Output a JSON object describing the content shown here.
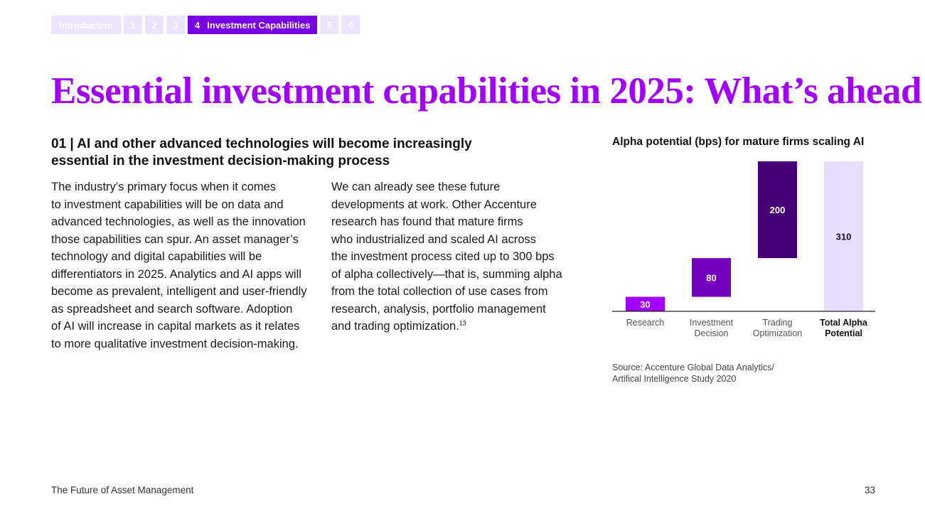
{
  "nav": {
    "intro": "Introduction",
    "tabs": [
      "1",
      "2",
      "3"
    ],
    "active_num": "4",
    "active_label": "Investment Capabilities",
    "tabs_after": [
      "5",
      "6"
    ]
  },
  "title": "Essential investment capabilities in 2025: What’s ahead",
  "section_heading": "01 | AI and other advanced technologies will become increasingly essential in the investment decision-making process",
  "column_1": "The industry’s primary focus when it comes\nto investment capabilities will be on data and\nadvanced technologies, as well as the innovation\nthose capabilities can spur. An asset manager’s\ntechnology and digital capabilities will be\ndifferentiators in 2025. Analytics and AI apps will\nbecome as prevalent, intelligent and user-friendly\nas spreadsheet and search software. Adoption\nof AI will increase in capital markets as it relates\nto more qualitative investment decision-making.",
  "column_2": "We can already see these future\ndevelopments at work. Other Accenture\nresearch has found that mature firms\nwho industrialized and scaled AI across\nthe investment process cited up to 300 bps\nof alpha collectively—that is, summing alpha\nfrom the total collection of use cases from\nresearch, analysis, portfolio management\nand trading optimization.",
  "column_2_footnote": "13",
  "chart_data": {
    "type": "bar",
    "subtype": "waterfall",
    "title": "Alpha potential (bps) for mature firms scaling AI",
    "categories": [
      "Research",
      "Investment\nDecision",
      "Trading\nOptimization",
      "Total Alpha\nPotential"
    ],
    "values": [
      30,
      80,
      200,
      310
    ],
    "is_total": [
      false,
      false,
      false,
      true
    ],
    "colors": [
      "#a100ff",
      "#7500c0",
      "#460073",
      "#e6dcff"
    ],
    "label_colors": [
      "#ffffff",
      "#ffffff",
      "#ffffff",
      "#111111"
    ],
    "ylim": [
      0,
      310
    ],
    "grid": false
  },
  "source": "Source: Accenture Global Data Analytics/\nArtifical Intelligence Study 2020",
  "footer": {
    "left": "The Future of Asset Management",
    "page_number": "33"
  }
}
